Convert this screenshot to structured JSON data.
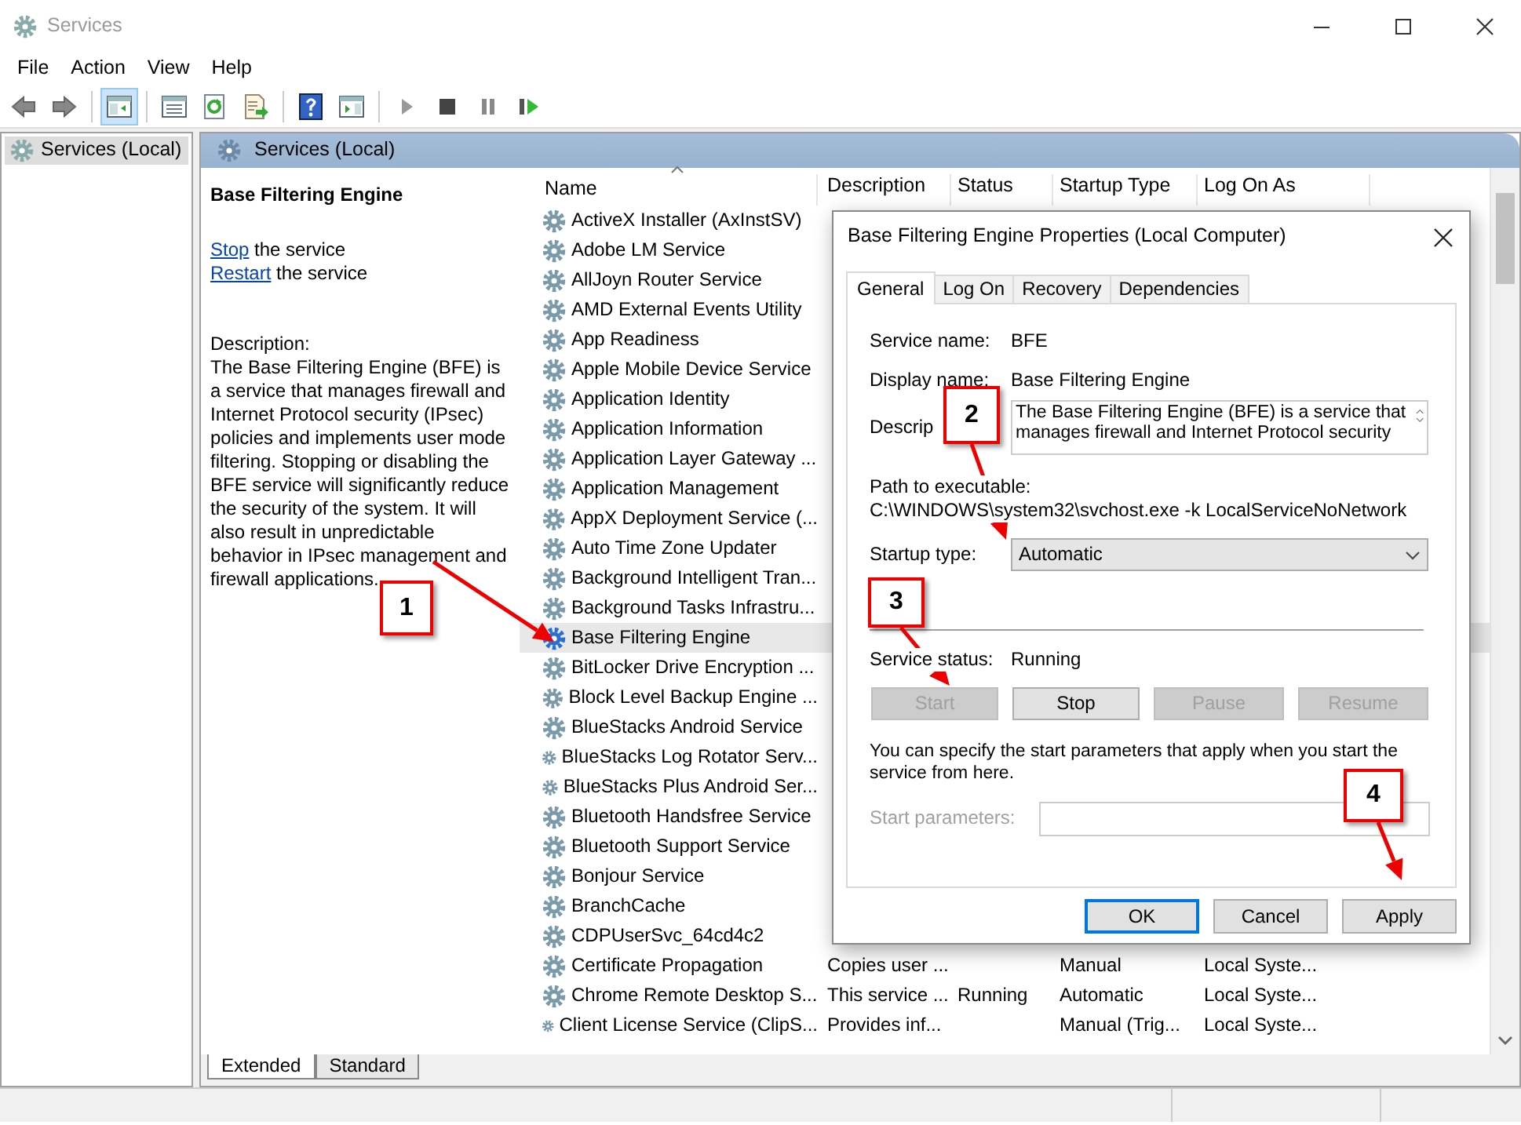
{
  "window": {
    "title": "Services"
  },
  "menu": [
    "File",
    "Action",
    "View",
    "Help"
  ],
  "toolbar": [
    {
      "kind": "back",
      "pressed": false
    },
    {
      "kind": "forward",
      "pressed": false
    },
    {
      "kind": "tree",
      "pressed": true
    },
    {
      "kind": "properties",
      "pressed": false
    },
    {
      "kind": "refresh",
      "pressed": false
    },
    {
      "kind": "export",
      "pressed": false
    },
    {
      "kind": "help",
      "pressed": false
    },
    {
      "kind": "actionpane",
      "pressed": false
    },
    {
      "kind": "play",
      "pressed": false
    },
    {
      "kind": "stop",
      "pressed": false
    },
    {
      "kind": "pause",
      "pressed": false
    },
    {
      "kind": "resume",
      "pressed": false
    }
  ],
  "tree": {
    "items": [
      {
        "label": "Services (Local)",
        "selected": true
      }
    ]
  },
  "pane_header": "Services (Local)",
  "extended": {
    "title": "Base Filtering Engine",
    "actions": [
      {
        "link": "Stop",
        "text": "the service"
      },
      {
        "link": "Restart",
        "text": "the service"
      }
    ],
    "description_label": "Description:",
    "description": "The Base Filtering Engine (BFE) is a service that manages firewall and Internet Protocol security (IPsec) policies and implements user mode filtering. Stopping or disabling the BFE service will significantly reduce the security of the system. It will also result in unpredictable behavior in IPsec management and firewall applications."
  },
  "table": {
    "columns": [
      "Name",
      "Description",
      "Status",
      "Startup Type",
      "Log On As"
    ],
    "rows": [
      {
        "name": "ActiveX Installer (AxInstSV)",
        "selected": false
      },
      {
        "name": "Adobe LM Service",
        "selected": false
      },
      {
        "name": "AllJoyn Router Service",
        "selected": false
      },
      {
        "name": "AMD External Events Utility",
        "selected": false
      },
      {
        "name": "App Readiness",
        "selected": false
      },
      {
        "name": "Apple Mobile Device Service",
        "selected": false
      },
      {
        "name": "Application Identity",
        "selected": false
      },
      {
        "name": "Application Information",
        "selected": false
      },
      {
        "name": "Application Layer Gateway ...",
        "selected": false
      },
      {
        "name": "Application Management",
        "selected": false
      },
      {
        "name": "AppX Deployment Service (...",
        "selected": false
      },
      {
        "name": "Auto Time Zone Updater",
        "selected": false
      },
      {
        "name": "Background Intelligent Tran...",
        "selected": false
      },
      {
        "name": "Background Tasks Infrastru...",
        "selected": false
      },
      {
        "name": "Base Filtering Engine",
        "selected": true
      },
      {
        "name": "BitLocker Drive Encryption ...",
        "selected": false
      },
      {
        "name": "Block Level Backup Engine ...",
        "selected": false
      },
      {
        "name": "BlueStacks Android Service",
        "selected": false
      },
      {
        "name": "BlueStacks Log Rotator Serv...",
        "selected": false
      },
      {
        "name": "BlueStacks Plus Android Ser...",
        "selected": false
      },
      {
        "name": "Bluetooth Handsfree Service",
        "selected": false
      },
      {
        "name": "Bluetooth Support Service",
        "selected": false
      },
      {
        "name": "Bonjour Service",
        "selected": false
      },
      {
        "name": "BranchCache",
        "selected": false
      },
      {
        "name": "CDPUserSvc_64cd4c2",
        "selected": false
      },
      {
        "name": "Certificate Propagation",
        "selected": false,
        "description": "Copies user ...",
        "startup_type": "Manual",
        "log_on_as": "Local Syste..."
      },
      {
        "name": "Chrome Remote Desktop S...",
        "selected": false,
        "description": "This service ...",
        "status": "Running",
        "startup_type": "Automatic",
        "log_on_as": "Local Syste..."
      },
      {
        "name": "Client License Service (ClipS...",
        "selected": false,
        "description": "Provides inf...",
        "startup_type": "Manual (Trig...",
        "log_on_as": "Local Syste..."
      }
    ]
  },
  "view_tabs": [
    {
      "label": "Extended",
      "selected": true
    },
    {
      "label": "Standard",
      "selected": false
    }
  ],
  "dialog": {
    "title": "Base Filtering Engine Properties (Local Computer)",
    "tabs": [
      {
        "label": "General",
        "selected": true
      },
      {
        "label": "Log On",
        "selected": false
      },
      {
        "label": "Recovery",
        "selected": false
      },
      {
        "label": "Dependencies",
        "selected": false
      }
    ],
    "service_name": {
      "label": "Service name:",
      "value": "BFE"
    },
    "display_name": {
      "label": "Display name:",
      "value": "Base Filtering Engine"
    },
    "description": {
      "label": "Descrip",
      "value": "The Base Filtering Engine (BFE) is a service that manages firewall and Internet Protocol security"
    },
    "path": {
      "label": "Path to executable:",
      "value": "C:\\WINDOWS\\system32\\svchost.exe -k LocalServiceNoNetwork"
    },
    "startup_type": {
      "label": "Startup type:",
      "value": "Automatic"
    },
    "service_status": {
      "label": "Service status:",
      "value": "Running"
    },
    "control_buttons": [
      {
        "label": "Start",
        "disabled": true
      },
      {
        "label": "Stop",
        "disabled": false
      },
      {
        "label": "Pause",
        "disabled": true
      },
      {
        "label": "Resume",
        "disabled": true
      }
    ],
    "hint": "You can specify the start parameters that apply when you start the service from here.",
    "start_parameters": {
      "label": "Start parameters:",
      "disabled": true
    },
    "buttons": [
      {
        "label": "OK",
        "default": true
      },
      {
        "label": "Cancel",
        "default": false
      },
      {
        "label": "Apply",
        "default": false
      }
    ]
  },
  "callouts": [
    {
      "label": "1"
    },
    {
      "label": "2"
    },
    {
      "label": "3"
    },
    {
      "label": "4"
    }
  ]
}
